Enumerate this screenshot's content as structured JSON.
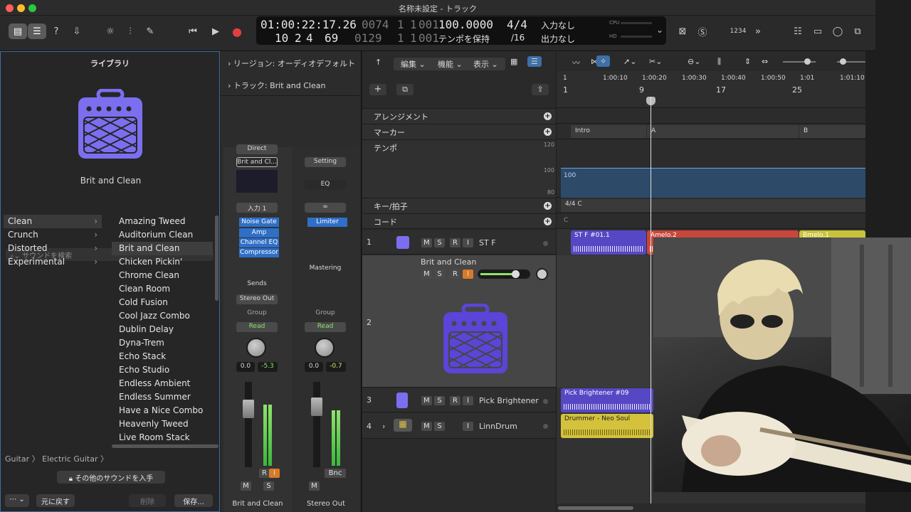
{
  "window": {
    "title": "名称未設定 - トラック"
  },
  "lcd": {
    "time": "01:00:22:17.26",
    "bars_top": [
      "0074",
      "1",
      "1",
      "001"
    ],
    "bars_bottom_prefix": [
      "10",
      "2",
      "4",
      "69"
    ],
    "bars_bottom": [
      "0129",
      "1",
      "1",
      "001"
    ],
    "tempo": "100.0000",
    "tempo_mode": "テンポを保持",
    "signature": "4/4",
    "division": "/16",
    "input": "入力なし",
    "output": "出力なし",
    "cpu": "CPU",
    "hd": "HD",
    "count": "1234"
  },
  "library": {
    "header": "ライブラリ",
    "patch_name": "Brit and Clean",
    "search_placeholder": "サウンドを検索",
    "categories": [
      {
        "label": "Clean",
        "selected": true
      },
      {
        "label": "Crunch"
      },
      {
        "label": "Distorted"
      },
      {
        "label": "Experimental"
      }
    ],
    "sounds": [
      "Amazing Tweed",
      "Auditorium Clean",
      "Brit and Clean",
      "Chicken Pickin'",
      "Chrome Clean",
      "Clean Room",
      "Cold Fusion",
      "Cool Jazz Combo",
      "Dublin Delay",
      "Dyna-Trem",
      "Echo Stack",
      "Echo Studio",
      "Endless Ambient",
      "Endless Summer",
      "Have a Nice Combo",
      "Heavenly Tweed",
      "Live Room Stack"
    ],
    "selected_sound": "Brit and Clean",
    "breadcrumb": "Guitar 〉 Electric Guitar 〉",
    "get_more": "その他のサウンドを入手",
    "revert": "元に戻す",
    "delete": "削除",
    "save": "保存..."
  },
  "inspector": {
    "region_label": "リージョン: オーディオデフォルト",
    "track_label": "トラック:  Brit and Clean",
    "strip1": {
      "direct": "Direct",
      "setting": "Brit and Cl...",
      "input": "入力 1",
      "plugins": [
        "Noise Gate",
        "Amp",
        "Channel EQ",
        "Compressor"
      ],
      "sends": "Sends",
      "output": "Stereo Out",
      "group": "Group",
      "read": "Read",
      "pan": "0.0",
      "gain": "-5.3",
      "name": "Brit and Clean",
      "m": "M",
      "s": "S",
      "r": "R",
      "i": "I"
    },
    "strip2": {
      "setting": "Setting",
      "eq": "EQ",
      "plugins": [
        "Limiter"
      ],
      "mastering": "Mastering",
      "group": "Group",
      "read": "Read",
      "pan": "0.0",
      "gain": "-0.7",
      "bnc": "Bnc",
      "name": "Stereo Out",
      "m": "M"
    }
  },
  "menus": {
    "edit": "編集",
    "function": "機能",
    "view": "表示"
  },
  "global_tracks": {
    "arrangement": "アレンジメント",
    "marker": "マーカー",
    "tempo": "テンポ",
    "key": "キー/拍子",
    "chord": "コード",
    "tempo_high": "120",
    "tempo_mid": "100",
    "tempo_low": "80",
    "tempo_value": "100",
    "key_sig": "C",
    "chord_label": "C"
  },
  "ruler": {
    "bars": [
      "1",
      "9",
      "17",
      "25"
    ],
    "times": [
      "1",
      "1:00:10",
      "1:00:20",
      "1:00:30",
      "1:00:40",
      "1:00:50",
      "1:01",
      "1:01:10"
    ]
  },
  "markers": [
    "Intro",
    "A",
    "B"
  ],
  "tracks": [
    {
      "num": "1",
      "name": "ST F",
      "m": "M",
      "s": "S",
      "r": "R",
      "i": "I"
    },
    {
      "num": "2",
      "name": "Brit and Clean",
      "m": "M",
      "s": "S",
      "r": "R",
      "i": "I"
    },
    {
      "num": "3",
      "name": "Pick Brightener",
      "m": "M",
      "s": "S",
      "r": "R",
      "i": "I"
    },
    {
      "num": "4",
      "name": "LinnDrum",
      "m": "M",
      "s": "S",
      "i": "I"
    }
  ],
  "regions": [
    {
      "label": "ST F #01.1",
      "color": "#5648c4"
    },
    {
      "label": "Amelo.2",
      "color": "#c8463a"
    },
    {
      "label": "Bmelo.1",
      "color": "#c8c43a"
    },
    {
      "label": "Pick Brightener #09",
      "color": "#5648c4"
    },
    {
      "label": "Drummer - Neo Soul",
      "color": "#d4c23c"
    }
  ],
  "colors": {
    "accent": "#3e6fa8",
    "amp": "#7b6ff0",
    "selected_amp": "#5a45d8"
  }
}
